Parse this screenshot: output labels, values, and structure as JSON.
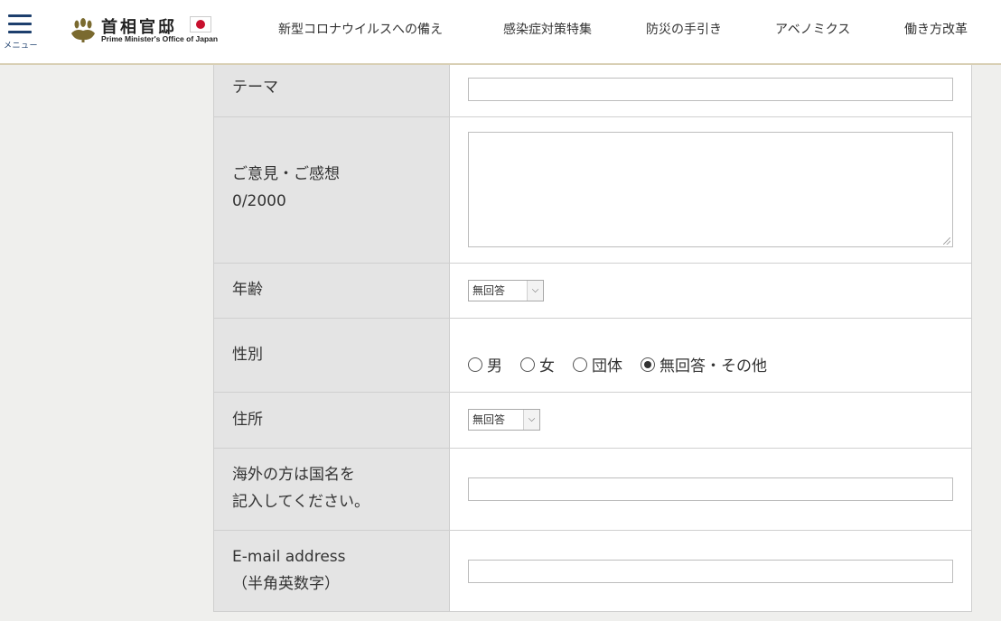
{
  "header": {
    "menu_label": "メニュー",
    "logo_title": "首相官邸",
    "logo_subtitle": "Prime Minister's Office of Japan"
  },
  "nav": [
    {
      "label": "新型コロナウイルスへの備え"
    },
    {
      "label": "感染症対策特集"
    },
    {
      "label": "防災の手引き"
    },
    {
      "label": "アベノミクス"
    },
    {
      "label": "働き方改革"
    }
  ],
  "form": {
    "theme": {
      "label": "テーマ",
      "value": ""
    },
    "opinion": {
      "label": "ご意見・ご感想",
      "counter": "0/2000",
      "value": ""
    },
    "age": {
      "label": "年齢",
      "selected": "無回答"
    },
    "gender": {
      "label": "性別",
      "options": [
        "男",
        "女",
        "団体",
        "無回答・その他"
      ],
      "selected": "無回答・その他"
    },
    "address": {
      "label": "住所",
      "selected": "無回答"
    },
    "country": {
      "label_line1": "海外の方は国名を",
      "label_line2": "記入してください。",
      "value": ""
    },
    "email": {
      "label_line1": "E-mail address",
      "label_line2": "（半角英数字）",
      "value": ""
    }
  },
  "colors": {
    "accent": "#1d3f6d",
    "header_border": "#d8cfb4",
    "label_bg": "#e4e4e4",
    "page_bg": "#efefed"
  }
}
